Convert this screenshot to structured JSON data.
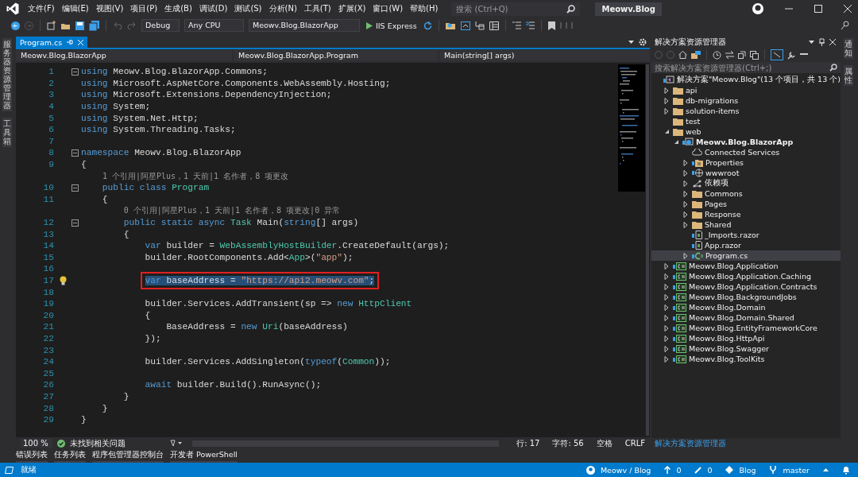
{
  "window": {
    "title": "Meowv.Blog"
  },
  "menu": [
    "文件(F)",
    "编辑(E)",
    "视图(V)",
    "项目(P)",
    "生成(B)",
    "调试(D)",
    "测试(S)",
    "分析(N)",
    "工具(T)",
    "扩展(X)",
    "窗口(W)",
    "帮助(H)"
  ],
  "search": {
    "placeholder": "搜索 (Ctrl+Q)"
  },
  "toolbar": {
    "configuration": "Debug",
    "platform": "Any CPU",
    "startup_project": "Meowv.Blog.BlazorApp",
    "run_target": "IIS Express"
  },
  "left_side_tabs": [
    "服务器资源管理器",
    "工具箱"
  ],
  "right_side_tabs": [
    "通知",
    "属性"
  ],
  "editor": {
    "tabs": [
      {
        "label": "Program.cs",
        "selected": true
      }
    ],
    "nav": [
      "Meowv.Blog.BlazorApp",
      "Meowv.Blog.BlazorApp.Program",
      "Main(string[] args)"
    ],
    "lines": [
      {
        "kind": "code",
        "num": "1",
        "fold": true,
        "lightbulb": false,
        "selected": false,
        "tokens": [
          {
            "kind": "kw",
            "text": "using"
          },
          {
            "kind": "plain",
            "text": " Meowv.Blog.BlazorApp.Commons;"
          }
        ]
      },
      {
        "kind": "code",
        "num": "2",
        "fold": false,
        "lightbulb": false,
        "selected": false,
        "tokens": [
          {
            "kind": "kw",
            "text": "using"
          },
          {
            "kind": "plain",
            "text": " Microsoft.AspNetCore.Components.WebAssembly.Hosting;"
          }
        ]
      },
      {
        "kind": "code",
        "num": "3",
        "fold": false,
        "lightbulb": false,
        "selected": false,
        "tokens": [
          {
            "kind": "kw",
            "text": "using"
          },
          {
            "kind": "plain",
            "text": " Microsoft.Extensions.DependencyInjection;"
          }
        ]
      },
      {
        "kind": "code",
        "num": "4",
        "fold": false,
        "lightbulb": false,
        "selected": false,
        "tokens": [
          {
            "kind": "kw",
            "text": "using"
          },
          {
            "kind": "plain",
            "text": " System;"
          }
        ]
      },
      {
        "kind": "code",
        "num": "5",
        "fold": false,
        "lightbulb": false,
        "selected": false,
        "tokens": [
          {
            "kind": "kw",
            "text": "using"
          },
          {
            "kind": "plain",
            "text": " System.Net.Http;"
          }
        ]
      },
      {
        "kind": "code",
        "num": "6",
        "fold": false,
        "lightbulb": false,
        "selected": false,
        "tokens": [
          {
            "kind": "kw",
            "text": "using"
          },
          {
            "kind": "plain",
            "text": " System.Threading.Tasks;"
          }
        ]
      },
      {
        "kind": "code",
        "num": "7",
        "fold": false,
        "lightbulb": false
      },
      {
        "kind": "code",
        "num": "8",
        "fold": true,
        "lightbulb": false,
        "selected": false,
        "tokens": [
          {
            "kind": "kw",
            "text": "namespace"
          },
          {
            "kind": "plain",
            "text": " Meowv.Blog.BlazorApp"
          }
        ]
      },
      {
        "kind": "code",
        "num": "9",
        "fold": false,
        "lightbulb": false,
        "selected": false,
        "tokens": [
          {
            "kind": "plain",
            "text": "{"
          }
        ],
        "children": [
          {
            "kind": "codelens",
            "text": "1 个引用|阿星Plus，1 天前|1 名作者，8 项更改"
          },
          {
            "kind": "code",
            "num": "10",
            "fold": true,
            "lightbulb": false,
            "selected": false,
            "tokens": [
              {
                "kind": "kw",
                "text": "public class"
              },
              {
                "kind": "type",
                "text": " Program"
              }
            ]
          },
          {
            "kind": "code",
            "num": "11",
            "fold": false,
            "lightbulb": false,
            "selected": false,
            "tokens": [
              {
                "kind": "plain",
                "text": "{"
              }
            ],
            "children": [
              {
                "kind": "codelens",
                "text": "0 个引用|阿星Plus，1 天前|1 名作者，8 项更改|0 异常"
              },
              {
                "kind": "code",
                "num": "12",
                "fold": true,
                "lightbulb": false,
                "selected": false,
                "tokens": [
                  {
                    "kind": "kw",
                    "text": "public static async"
                  },
                  {
                    "kind": "type",
                    "text": " Task"
                  },
                  {
                    "kind": "plain",
                    "text": " Main("
                  },
                  {
                    "kind": "kw",
                    "text": "string"
                  },
                  {
                    "kind": "plain",
                    "text": "[] args)"
                  }
                ]
              },
              {
                "kind": "code",
                "num": "13",
                "fold": false,
                "lightbulb": false,
                "selected": false,
                "tokens": [
                  {
                    "kind": "plain",
                    "text": "{"
                  }
                ],
                "children": [
                  {
                    "kind": "code",
                    "num": "14",
                    "fold": false,
                    "lightbulb": false,
                    "selected": false,
                    "tokens": [
                      {
                        "kind": "kw",
                        "text": "var"
                      },
                      {
                        "kind": "plain",
                        "text": " builder = "
                      },
                      {
                        "kind": "type",
                        "text": "WebAssemblyHostBuilder"
                      },
                      {
                        "kind": "plain",
                        "text": ".CreateDefault(args);"
                      }
                    ]
                  },
                  {
                    "kind": "code",
                    "num": "15",
                    "fold": false,
                    "lightbulb": false,
                    "selected": false,
                    "tokens": [
                      {
                        "kind": "plain",
                        "text": "builder.RootComponents.Add<"
                      },
                      {
                        "kind": "type",
                        "text": "App"
                      },
                      {
                        "kind": "plain",
                        "text": ">("
                      },
                      {
                        "kind": "str",
                        "text": "\"app\""
                      },
                      {
                        "kind": "plain",
                        "text": ");"
                      }
                    ]
                  },
                  {
                    "kind": "code",
                    "num": "16",
                    "fold": false,
                    "lightbulb": false
                  },
                  {
                    "kind": "code",
                    "num": "17",
                    "fold": false,
                    "lightbulb": true,
                    "selected": true,
                    "tokens": [
                      {
                        "kind": "kw",
                        "text": "var"
                      },
                      {
                        "kind": "plain",
                        "text": " baseAddress = "
                      },
                      {
                        "kind": "str",
                        "text": "\"https://api2.meowv.com\""
                      },
                      {
                        "kind": "plain",
                        "text": ";"
                      }
                    ]
                  },
                  {
                    "kind": "code",
                    "num": "18",
                    "fold": false,
                    "lightbulb": false
                  },
                  {
                    "kind": "code",
                    "num": "19",
                    "fold": false,
                    "lightbulb": false,
                    "selected": false,
                    "tokens": [
                      {
                        "kind": "plain",
                        "text": "builder.Services.AddTransient(sp => "
                      },
                      {
                        "kind": "kw",
                        "text": "new"
                      },
                      {
                        "kind": "type",
                        "text": " HttpClient"
                      }
                    ]
                  },
                  {
                    "kind": "code",
                    "num": "20",
                    "fold": false,
                    "lightbulb": false,
                    "selected": false,
                    "tokens": [
                      {
                        "kind": "plain",
                        "text": "{"
                      }
                    ],
                    "children": [
                      {
                        "kind": "code",
                        "num": "21",
                        "fold": false,
                        "lightbulb": false,
                        "selected": false,
                        "tokens": [
                          {
                            "kind": "plain",
                            "text": "BaseAddress = "
                          },
                          {
                            "kind": "kw",
                            "text": "new"
                          },
                          {
                            "kind": "type",
                            "text": " Uri"
                          },
                          {
                            "kind": "plain",
                            "text": "(baseAddress)"
                          }
                        ]
                      }
                    ]
                  },
                  {
                    "kind": "code",
                    "num": "22",
                    "fold": false,
                    "lightbulb": false,
                    "selected": false,
                    "tokens": [
                      {
                        "kind": "plain",
                        "text": "});"
                      }
                    ]
                  },
                  {
                    "kind": "code",
                    "num": "23",
                    "fold": false,
                    "lightbulb": false
                  },
                  {
                    "kind": "code",
                    "num": "24",
                    "fold": false,
                    "lightbulb": false,
                    "selected": false,
                    "tokens": [
                      {
                        "kind": "plain",
                        "text": "builder.Services.AddSingleton("
                      },
                      {
                        "kind": "kw",
                        "text": "typeof"
                      },
                      {
                        "kind": "plain",
                        "text": "("
                      },
                      {
                        "kind": "type",
                        "text": "Common"
                      },
                      {
                        "kind": "plain",
                        "text": "));"
                      }
                    ]
                  },
                  {
                    "kind": "code",
                    "num": "25",
                    "fold": false,
                    "lightbulb": false
                  },
                  {
                    "kind": "code",
                    "num": "26",
                    "fold": false,
                    "lightbulb": false,
                    "selected": false,
                    "tokens": [
                      {
                        "kind": "kw",
                        "text": "await"
                      },
                      {
                        "kind": "plain",
                        "text": " builder.Build().RunAsync();"
                      }
                    ]
                  }
                ]
              },
              {
                "kind": "code",
                "num": "27",
                "fold": false,
                "lightbulb": false,
                "selected": false,
                "tokens": [
                  {
                    "kind": "plain",
                    "text": "}"
                  }
                ]
              }
            ]
          },
          {
            "kind": "code",
            "num": "28",
            "fold": false,
            "lightbulb": false,
            "selected": false,
            "tokens": [
              {
                "kind": "plain",
                "text": "}"
              }
            ]
          }
        ]
      },
      {
        "kind": "code",
        "num": "29",
        "fold": false,
        "lightbulb": false,
        "selected": false,
        "tokens": [
          {
            "kind": "plain",
            "text": "}"
          }
        ]
      }
    ],
    "zoom": "100 %",
    "issues": "未找到相关问题",
    "position": [
      "行: 17",
      "字符: 56",
      "空格",
      "CRLF"
    ]
  },
  "solution_explorer": {
    "title": "解决方案资源管理器",
    "search_placeholder": "搜索解决方案资源管理器(Ctrl+;)",
    "tree": [
      {
        "kind": "solution",
        "label": "解决方案\"Meowv.Blog\"(13 个项目，共 13 个)",
        "selected": false,
        "children": [
          {
            "kind": "folder",
            "label": "api",
            "expanded": false,
            "selected": false
          },
          {
            "kind": "folder",
            "label": "db-migrations",
            "expanded": false,
            "selected": false
          },
          {
            "kind": "folder",
            "label": "solution-items",
            "expanded": false,
            "selected": false
          },
          {
            "kind": "folder",
            "label": "test",
            "selected": false
          },
          {
            "kind": "folder",
            "label": "web",
            "expanded": true,
            "selected": false,
            "children": [
              {
                "kind": "project",
                "label": "Meowv.Blog.BlazorApp",
                "expanded": true,
                "selected": false,
                "children": [
                  {
                    "kind": "service",
                    "label": "Connected Services",
                    "selected": false
                  },
                  {
                    "kind": "properties",
                    "label": "Properties",
                    "expanded": false,
                    "selected": false
                  },
                  {
                    "kind": "web",
                    "label": "wwwroot",
                    "expanded": false,
                    "selected": false
                  },
                  {
                    "kind": "dependencies",
                    "label": "依赖项",
                    "expanded": false,
                    "selected": false
                  },
                  {
                    "kind": "folder",
                    "label": "Commons",
                    "expanded": false,
                    "selected": false
                  },
                  {
                    "kind": "folder",
                    "label": "Pages",
                    "expanded": false,
                    "selected": false
                  },
                  {
                    "kind": "folder",
                    "label": "Response",
                    "expanded": false,
                    "selected": false
                  },
                  {
                    "kind": "folder",
                    "label": "Shared",
                    "expanded": false,
                    "selected": false
                  },
                  {
                    "kind": "razor",
                    "label": "_Imports.razor",
                    "selected": false
                  },
                  {
                    "kind": "razor",
                    "label": "App.razor",
                    "selected": false
                  },
                  {
                    "kind": "csharp",
                    "label": "Program.cs",
                    "expanded": false,
                    "selected": true
                  }
                ]
              }
            ]
          },
          {
            "kind": "library",
            "label": "Meowv.Blog.Application",
            "expanded": false,
            "selected": false
          },
          {
            "kind": "library",
            "label": "Meowv.Blog.Application.Caching",
            "expanded": false,
            "selected": false
          },
          {
            "kind": "library",
            "label": "Meowv.Blog.Application.Contracts",
            "expanded": false,
            "selected": false
          },
          {
            "kind": "library",
            "label": "Meowv.Blog.BackgroundJobs",
            "expanded": false,
            "selected": false
          },
          {
            "kind": "library",
            "label": "Meowv.Blog.Domain",
            "expanded": false,
            "selected": false
          },
          {
            "kind": "library",
            "label": "Meowv.Blog.Domain.Shared",
            "expanded": false,
            "selected": false
          },
          {
            "kind": "library",
            "label": "Meowv.Blog.EntityFrameworkCore",
            "expanded": false,
            "selected": false
          },
          {
            "kind": "library",
            "label": "Meowv.Blog.HttpApi",
            "expanded": false,
            "selected": false
          },
          {
            "kind": "library",
            "label": "Meowv.Blog.Swagger",
            "expanded": false,
            "selected": false
          },
          {
            "kind": "library",
            "label": "Meowv.Blog.ToolKits",
            "expanded": false,
            "selected": false
          }
        ]
      }
    ],
    "bottom_tabs": [
      "解决方案资源管理器"
    ]
  },
  "tool_tabs": [
    "错误列表",
    "任务列表",
    "程序包管理器控制台",
    "开发者 PowerShell"
  ],
  "status_bar": {
    "message": "就绪",
    "repo": "Meowv / Blog",
    "push_count": "0",
    "changes_count": "0",
    "repo_name": "Blog",
    "branch": "master"
  }
}
